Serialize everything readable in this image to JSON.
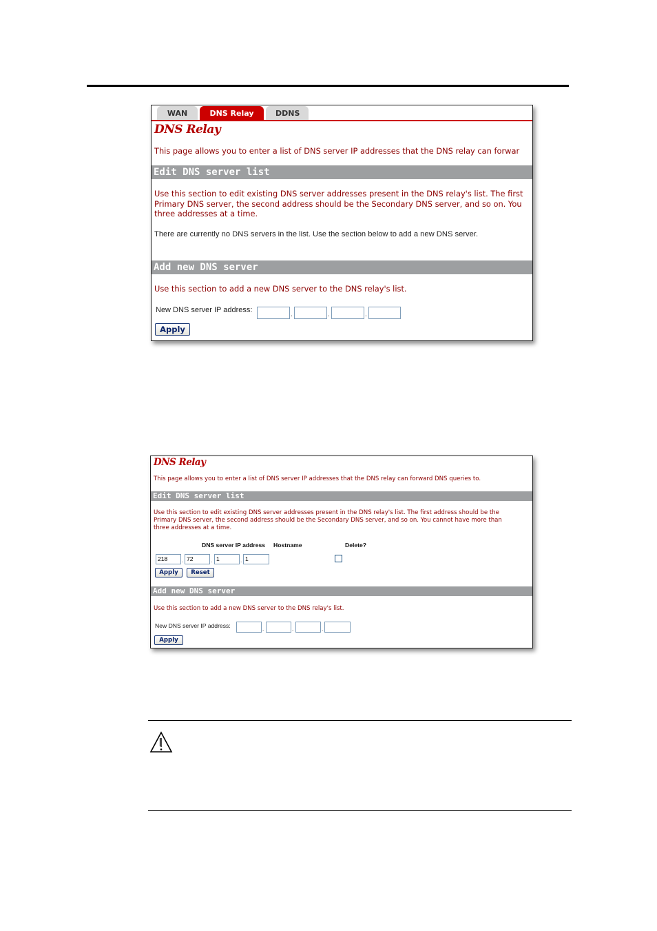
{
  "screenshot1": {
    "tabs": [
      {
        "label": "WAN",
        "active": false
      },
      {
        "label": "DNS Relay",
        "active": true
      },
      {
        "label": "DDNS",
        "active": false
      }
    ],
    "title": "DNS Relay",
    "intro": "This page allows you to enter a list of DNS server IP addresses that the DNS relay can forwar",
    "edit_section": {
      "heading": "Edit DNS server list",
      "description_lines": [
        "Use this section to edit existing DNS server addresses present in the DNS relay's list. The first",
        "Primary DNS server, the second address should be the Secondary DNS server, and so on. You",
        "three addresses at a time."
      ],
      "empty_message": "There are currently no DNS servers in the list. Use the section below to add a new DNS server."
    },
    "add_section": {
      "heading": "Add new DNS server",
      "description": "Use this section to add a new DNS server to the DNS relay's list.",
      "ip_label": "New DNS server IP address:",
      "ip_octets": [
        "",
        "",
        "",
        ""
      ],
      "separator": ".",
      "apply_label": "Apply"
    }
  },
  "screenshot2": {
    "title": "DNS Relay",
    "intro": "This page allows you to enter a list of DNS server IP addresses that the DNS relay can forward DNS queries to.",
    "edit_section": {
      "heading": "Edit DNS server list",
      "description_lines": [
        "Use this section to edit existing DNS server addresses present in the DNS relay's list. The first address should be the",
        "Primary DNS server, the second address should be the Secondary DNS server, and so on. You cannot have more than",
        "three addresses at a time."
      ],
      "columns": [
        "DNS server IP address",
        "Hostname",
        "Delete?"
      ],
      "entries": [
        {
          "octets": [
            "218",
            "72",
            "1",
            "1"
          ],
          "hostname": "",
          "delete": false
        }
      ],
      "separator": ".",
      "apply_label": "Apply",
      "reset_label": "Reset"
    },
    "add_section": {
      "heading": "Add new DNS server",
      "description": "Use this section to add a new DNS server to the DNS relay's list.",
      "ip_label": "New DNS server IP address:",
      "ip_octets": [
        "",
        "",
        "",
        ""
      ],
      "separator": ".",
      "apply_label": "Apply"
    }
  },
  "caution": {
    "icon": "warning-triangle-icon"
  },
  "colors": {
    "accent_red": "#cc0000",
    "text_red": "#8b0000",
    "section_bar": "#9d9fa1",
    "tab_inactive": "#d9d9d9"
  }
}
